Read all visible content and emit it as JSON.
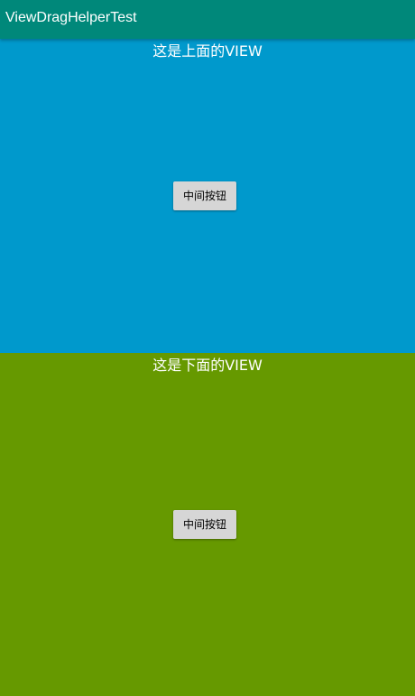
{
  "toolbar": {
    "title": "ViewDragHelperTest"
  },
  "top_view": {
    "label": "这是上面的VIEW",
    "button_label": "中间按钮"
  },
  "bottom_view": {
    "label": "这是下面的VIEW",
    "button_label": "中间按钮"
  },
  "colors": {
    "toolbar": "#00887a",
    "top_view": "#0099cc",
    "bottom_view": "#669900",
    "button": "#d6d6d6"
  }
}
